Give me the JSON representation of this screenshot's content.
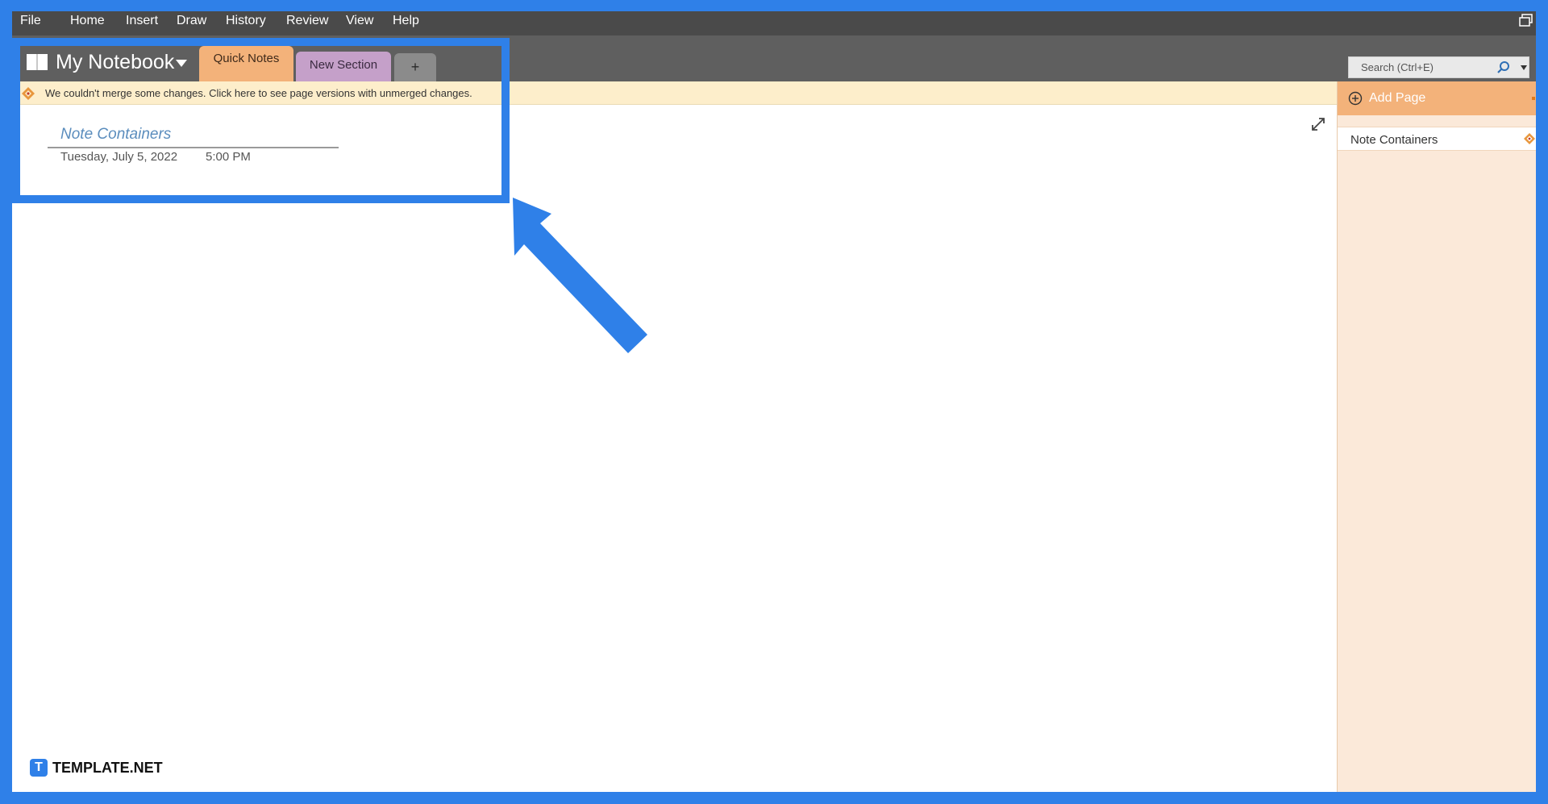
{
  "menubar": {
    "items": [
      "File",
      "Home",
      "Insert",
      "Draw",
      "History",
      "Review",
      "View",
      "Help"
    ]
  },
  "notebook": {
    "title": "My Notebook",
    "tabs": {
      "quick_notes": "Quick Notes",
      "new_section": "New Section",
      "add": "+"
    }
  },
  "search": {
    "placeholder": "Search (Ctrl+E)"
  },
  "infobar": {
    "message": "We couldn't merge some changes. Click here to see page versions with unmerged changes."
  },
  "page": {
    "title": "Note Containers",
    "date": "Tuesday, July 5, 2022",
    "time": "5:00 PM"
  },
  "sidebar": {
    "add_page_label": "Add Page",
    "pages": [
      "Note Containers"
    ]
  },
  "watermark": {
    "badge": "T",
    "text": "TEMPLATE.NET"
  },
  "colors": {
    "annotation": "#2f80e8",
    "quick_notes_tab": "#f3b27a",
    "new_section_tab": "#c5a0c9"
  }
}
